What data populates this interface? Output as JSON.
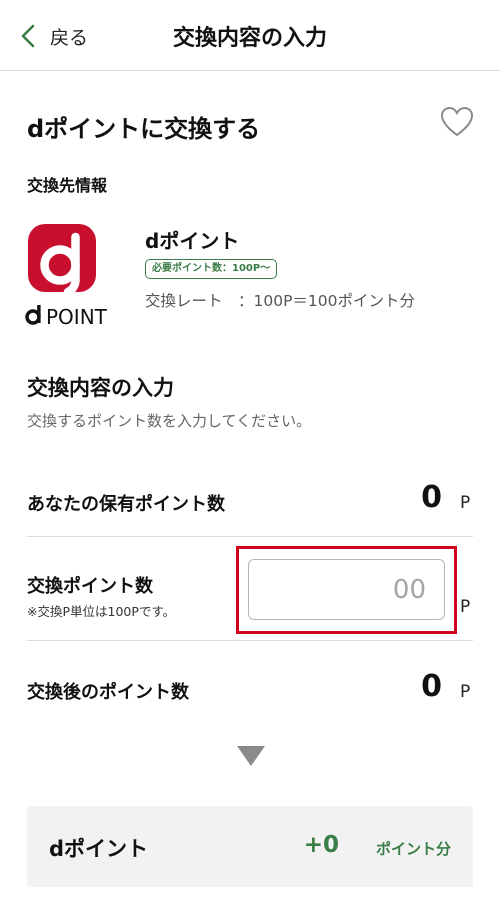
{
  "header": {
    "back_label": "戻る",
    "title": "交換内容の入力"
  },
  "section": {
    "title": "dポイントに交換する",
    "info_label": "交換先情報"
  },
  "partner": {
    "name": "dポイント",
    "logo_text": "POINT",
    "required_badge": "必要ポイント数：100P〜",
    "rate_text": "交換レート　：100P＝100ポイント分",
    "brand_color": "#c8102e"
  },
  "input_section": {
    "title": "交換内容の入力",
    "description": "交換するポイント数を入力してください。"
  },
  "rows": {
    "held": {
      "label": "あなたの保有ポイント数",
      "value": "0",
      "unit": "P"
    },
    "exchange": {
      "label": "交換ポイント数",
      "note": "※交換P単位は100Pです。",
      "placeholder": "00",
      "value": "",
      "unit": "P"
    },
    "after": {
      "label": "交換後のポイント数",
      "value": "0",
      "unit": "P"
    }
  },
  "result": {
    "name": "dポイント",
    "amount": "+0",
    "unit": "ポイント分"
  },
  "colors": {
    "accent_green": "#3a7d46",
    "highlight_red": "#d0021b"
  },
  "icons": {
    "back": "chevron-left-icon",
    "favorite": "heart-outline-icon",
    "arrow": "triangle-down-icon"
  }
}
